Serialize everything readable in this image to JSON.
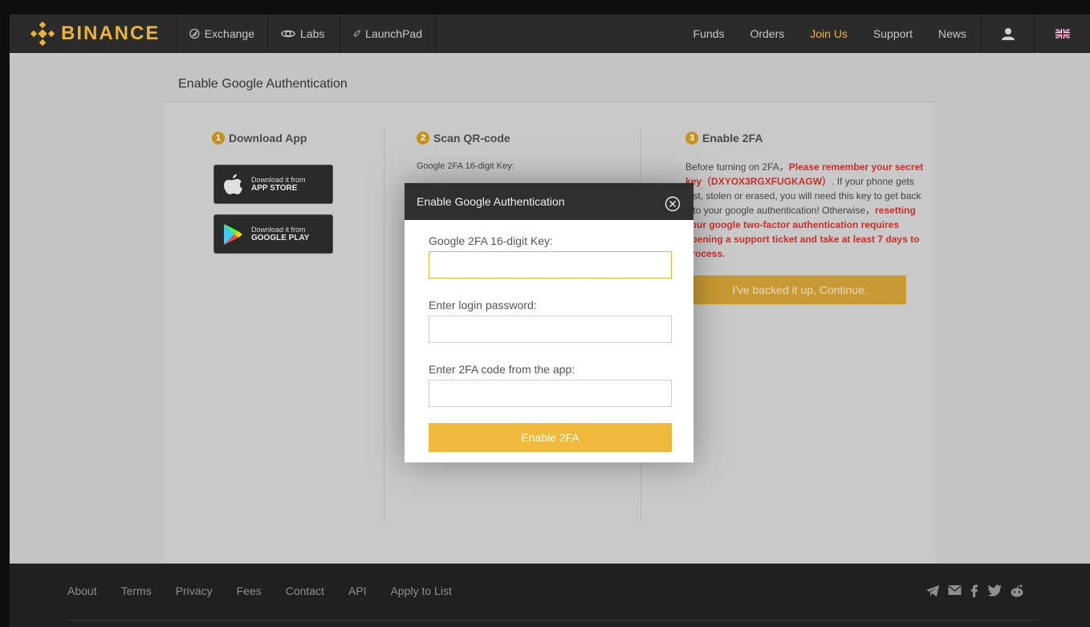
{
  "brand": {
    "name": "BINANCE",
    "color": "#e8b43a"
  },
  "nav": {
    "left": [
      {
        "label": "Exchange",
        "icon": "exchange-icon"
      },
      {
        "label": "Labs",
        "icon": "labs-icon"
      },
      {
        "label": "LaunchPad",
        "icon": "rocket-icon"
      }
    ],
    "right": [
      "Funds",
      "Orders",
      "Join Us",
      "Support",
      "News"
    ],
    "active": "Join Us",
    "user_icon": "user-icon",
    "language_icon": "uk-flag-icon"
  },
  "page": {
    "title": "Enable Google Authentication",
    "step1": {
      "number": "1",
      "title": "Download App",
      "app_store": {
        "line1": "Download it from",
        "line2": "APP STORE"
      },
      "google_play": {
        "line1": "Download it from",
        "line2": "GOOGLE PLAY"
      }
    },
    "step2": {
      "number": "2",
      "title": "Scan QR-code",
      "key_label": "Google 2FA 16-digit Key:"
    },
    "step3": {
      "number": "3",
      "title": "Enable 2FA",
      "text_1": "Before turning on 2FA，",
      "text_red_1": "Please remember your secret key（DXYOX3RGXFUGKAGW）",
      "text_2": ". If your phone gets lost, stolen or erased, you will need this key to get back into your google authentication! Otherwise，",
      "text_red_2": "resetting your google two-factor authentication requires opening a support ticket and take at least 7 days to process.",
      "continue_label": "I've backed it up, Continue."
    }
  },
  "modal": {
    "title": "Enable Google Authentication",
    "close_icon": "close-circle-icon",
    "fields": [
      {
        "label": "Google 2FA 16-digit Key:",
        "value": "",
        "placeholder": ""
      },
      {
        "label": "Enter login password:",
        "value": "",
        "placeholder": ""
      },
      {
        "label": "Enter 2FA code from the app:",
        "value": "",
        "placeholder": ""
      }
    ],
    "submit_label": "Enable 2FA",
    "accent": "#f0b93b"
  },
  "footer": {
    "links": [
      "About",
      "Terms",
      "Privacy",
      "Fees",
      "Contact",
      "API",
      "Apply to List"
    ],
    "social_icons": [
      "telegram-icon",
      "mail-icon",
      "facebook-icon",
      "twitter-icon",
      "reddit-icon"
    ]
  }
}
